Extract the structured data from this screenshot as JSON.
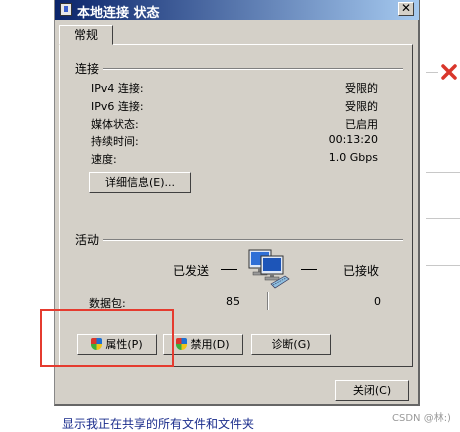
{
  "window": {
    "title": "本地连接 状态",
    "close_glyph": "✕"
  },
  "tabs": [
    {
      "label": "常规"
    }
  ],
  "connection": {
    "group_label": "连接",
    "rows": [
      {
        "label": "IPv4 连接:",
        "value": "受限的"
      },
      {
        "label": "IPv6 连接:",
        "value": "受限的"
      },
      {
        "label": "媒体状态:",
        "value": "已启用"
      },
      {
        "label": "持续时间:",
        "value": "00:13:20"
      },
      {
        "label": "速度:",
        "value": "1.0 Gbps"
      }
    ],
    "details_button": "详细信息(E)..."
  },
  "activity": {
    "group_label": "活动",
    "sent_label": "已发送",
    "received_label": "已接收",
    "packets_label": "数据包:",
    "packets_sent": "85",
    "packets_received": "0"
  },
  "actions": {
    "properties_button": "属性(P)",
    "disable_button": "禁用(D)",
    "diagnose_button": "诊断(G)"
  },
  "footer": {
    "close_button": "关闭(C)"
  },
  "background": {
    "link_text": "显示我正在共享的所有文件和文件夹",
    "watermark": "CSDN @林:)"
  },
  "colors": {
    "annotation": "#e53b2f",
    "titlebar": "#0a246a",
    "dialog_bg": "#d4d0c8",
    "x_icon": "#d9362b"
  },
  "icons": [
    "network-icon",
    "shield-icon",
    "network-computers-icon",
    "red-x-icon"
  ]
}
